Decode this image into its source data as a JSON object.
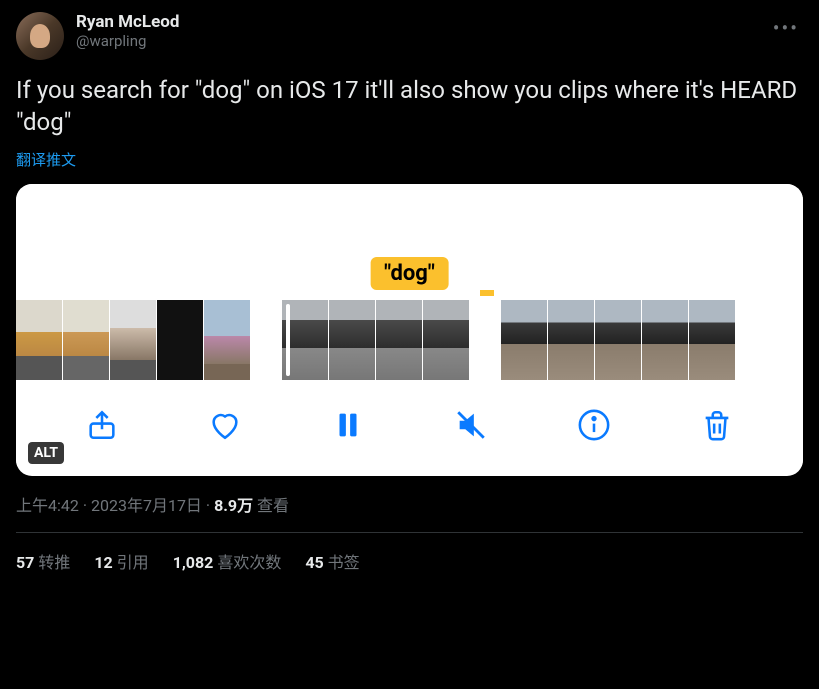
{
  "author": {
    "display_name": "Ryan McLeod",
    "handle": "@warpling"
  },
  "tweet_text": "If you search for \"dog\" on iOS 17 it'll also show you clips where it's HEARD \"dog\"",
  "translate_label": "翻译推文",
  "media": {
    "badge_text": "\"dog\"",
    "alt_badge": "ALT"
  },
  "meta": {
    "time": "上午4:42",
    "dot": " · ",
    "date": "2023年7月17日",
    "views_count": "8.9万",
    "views_label": " 查看"
  },
  "stats": {
    "retweets_num": "57",
    "retweets_label": " 转推",
    "quotes_num": "12",
    "quotes_label": " 引用",
    "likes_num": "1,082",
    "likes_label": " 喜欢次数",
    "bookmarks_num": "45",
    "bookmarks_label": " 书签"
  }
}
